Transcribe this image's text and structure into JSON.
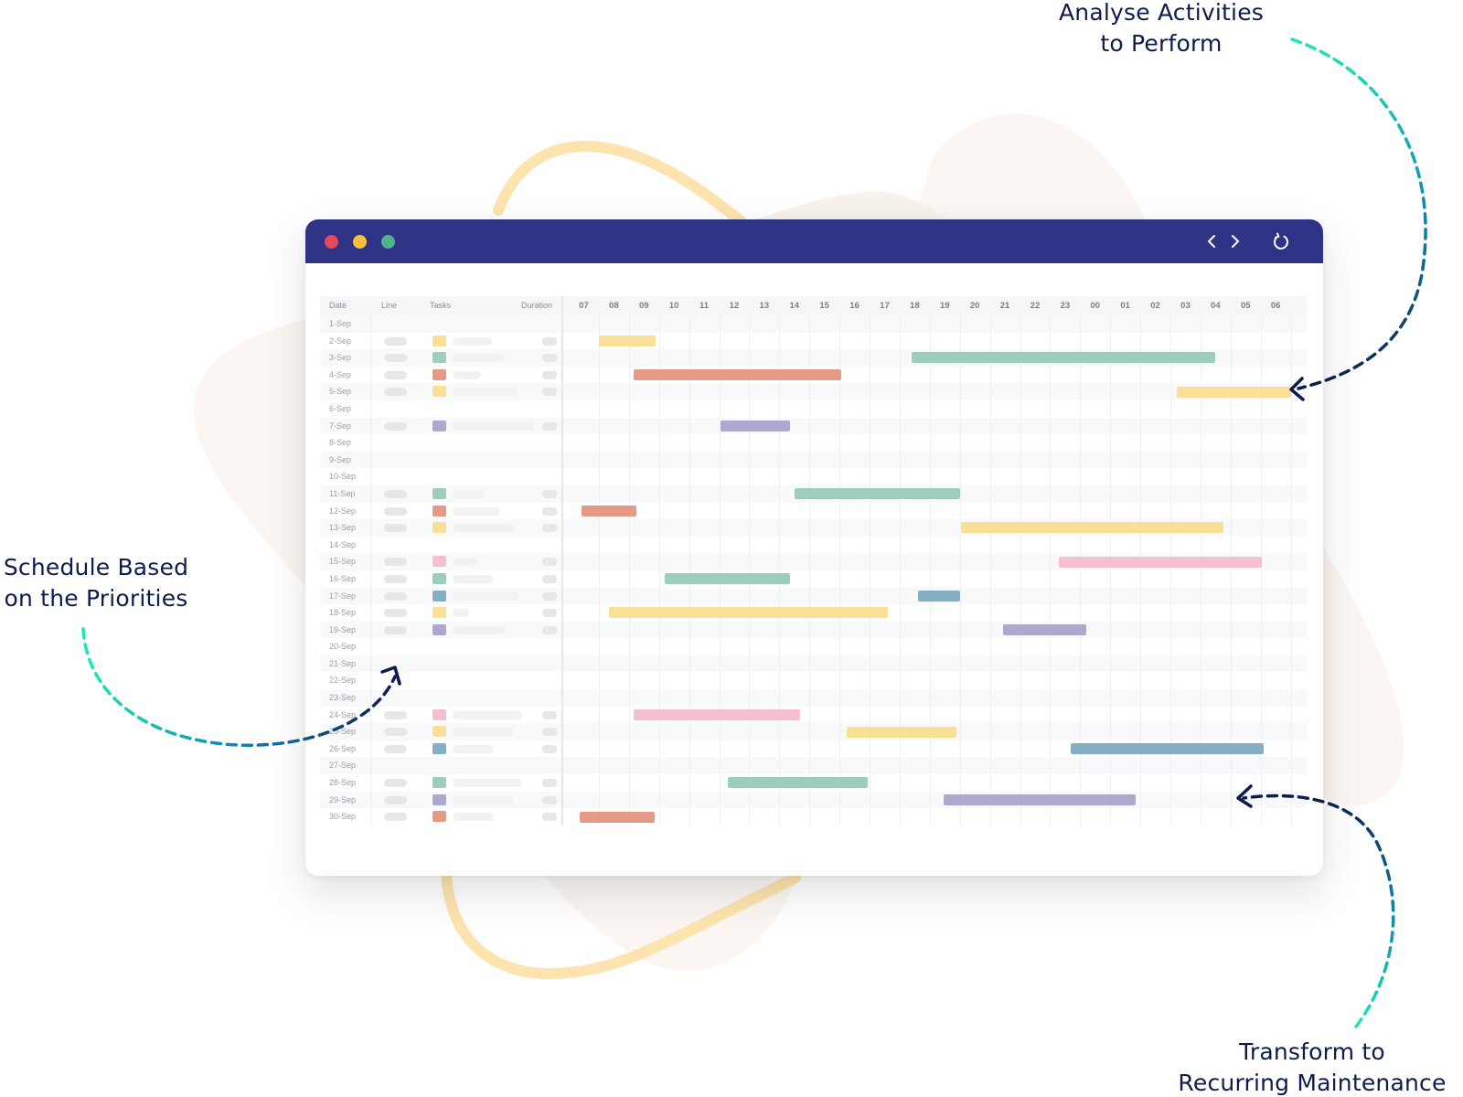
{
  "callouts": {
    "analyse": [
      "Analyse Activities",
      "to Perform"
    ],
    "schedule": [
      "Schedule Based",
      "on the Priorities"
    ],
    "transform": [
      "Transform to",
      "Recurring Maintenance"
    ]
  },
  "window": {
    "controls": [
      "close",
      "minimize",
      "maximize"
    ],
    "toolbar_icons": {
      "back": "chevron-left-icon",
      "forward": "chevron-right-icon",
      "refresh": "refresh-icon"
    },
    "colors": {
      "titlebar": "#2e3386",
      "close": "#e8485a",
      "minimize": "#f6c137",
      "maximize": "#4fb38e"
    }
  },
  "palette": {
    "yellow": "#fae096",
    "green": "#9dcebc",
    "orange": "#e49a85",
    "purple": "#aea8d1",
    "pink": "#f4c0cf",
    "blue": "#84afc5"
  },
  "gantt": {
    "columns": {
      "date": "Date",
      "line": "Line",
      "tasks": "Tasks",
      "duration": "Duration"
    },
    "hours": [
      "07",
      "08",
      "09",
      "10",
      "11",
      "12",
      "13",
      "14",
      "15",
      "16",
      "17",
      "18",
      "19",
      "20",
      "21",
      "22",
      "23",
      "00",
      "01",
      "02",
      "03",
      "04",
      "05",
      "06"
    ],
    "rows": [
      {
        "date": "1-Sep"
      },
      {
        "date": "2-Sep",
        "color": "yellow",
        "task_len": 0.45,
        "start_hour": 1.0,
        "end_hour": 2.9
      },
      {
        "date": "3-Sep",
        "color": "green",
        "task_len": 0.6,
        "start_hour": 11.4,
        "end_hour": 21.5
      },
      {
        "date": "4-Sep",
        "color": "orange",
        "task_len": 0.33,
        "start_hour": 2.15,
        "end_hour": 9.05
      },
      {
        "date": "5-Sep",
        "color": "yellow",
        "task_len": 0.75,
        "start_hour": 20.2,
        "end_hour": 24.0
      },
      {
        "date": "6-Sep"
      },
      {
        "date": "7-Sep",
        "color": "purple",
        "task_len": 0.95,
        "start_hour": 5.05,
        "end_hour": 7.35
      },
      {
        "date": "8-Sep"
      },
      {
        "date": "9-Sep"
      },
      {
        "date": "10-Sep"
      },
      {
        "date": "11-Sep",
        "color": "green",
        "task_len": 0.37,
        "start_hour": 7.5,
        "end_hour": 13.0
      },
      {
        "date": "12-Sep",
        "color": "orange",
        "task_len": 0.55,
        "start_hour": 0.43,
        "end_hour": 2.25
      },
      {
        "date": "13-Sep",
        "color": "yellow",
        "task_len": 0.7,
        "start_hour": 13.05,
        "end_hour": 21.75
      },
      {
        "date": "14-Sep"
      },
      {
        "date": "15-Sep",
        "color": "pink",
        "task_len": 0.28,
        "start_hour": 16.3,
        "end_hour": 23.05
      },
      {
        "date": "16-Sep",
        "color": "green",
        "task_len": 0.46,
        "start_hour": 3.2,
        "end_hour": 7.35
      },
      {
        "date": "17-Sep",
        "color": "blue",
        "task_len": 0.77,
        "start_hour": 11.6,
        "end_hour": 13.0
      },
      {
        "date": "18-Sep",
        "color": "yellow",
        "task_len": 0.19,
        "start_hour": 1.35,
        "end_hour": 10.6
      },
      {
        "date": "19-Sep",
        "color": "purple",
        "task_len": 0.61,
        "start_hour": 14.45,
        "end_hour": 17.2
      },
      {
        "date": "20-Sep"
      },
      {
        "date": "21-Sep"
      },
      {
        "date": "22-Sep"
      },
      {
        "date": "23-Sep"
      },
      {
        "date": "24-Sep",
        "color": "pink",
        "task_len": 0.8,
        "start_hour": 2.15,
        "end_hour": 7.7
      },
      {
        "date": "25-Sep",
        "color": "yellow",
        "task_len": 0.7,
        "start_hour": 9.25,
        "end_hour": 12.9
      },
      {
        "date": "26-Sep",
        "color": "blue",
        "task_len": 0.47,
        "start_hour": 16.7,
        "end_hour": 23.1
      },
      {
        "date": "27-Sep"
      },
      {
        "date": "28-Sep",
        "color": "green",
        "task_len": 0.8,
        "start_hour": 5.3,
        "end_hour": 9.95
      },
      {
        "date": "29-Sep",
        "color": "purple",
        "task_len": 0.7,
        "start_hour": 12.45,
        "end_hour": 18.85
      },
      {
        "date": "30-Sep",
        "color": "orange",
        "task_len": 0.47,
        "start_hour": 0.35,
        "end_hour": 2.85
      }
    ]
  }
}
